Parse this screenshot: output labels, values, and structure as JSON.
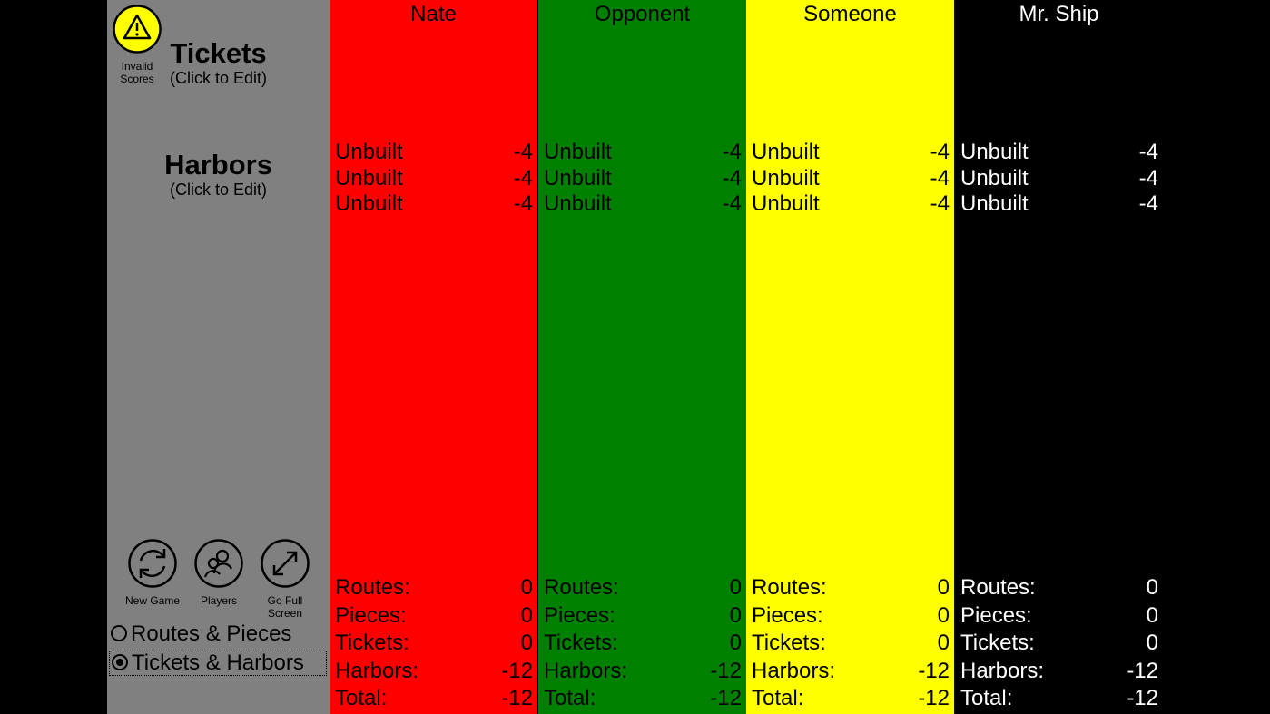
{
  "sidebar": {
    "invalid_label": "Invalid Scores",
    "tickets_title": "Tickets",
    "tickets_sub": "(Click to Edit)",
    "harbors_title": "Harbors",
    "harbors_sub": "(Click to Edit)",
    "tools": {
      "new_game": "New Game",
      "players": "Players",
      "full_screen": "Go Full Screen"
    },
    "modes": [
      {
        "label": "Routes & Pieces",
        "selected": false
      },
      {
        "label": "Tickets & Harbors",
        "selected": true
      }
    ]
  },
  "stat_labels": {
    "routes": "Routes:",
    "pieces": "Pieces:",
    "tickets": "Tickets:",
    "harbors": "Harbors:",
    "total": "Total:"
  },
  "players": [
    {
      "name": "Nate",
      "color": "#ff0000",
      "text_color": "#000000",
      "harbors": [
        {
          "label": "Unbuilt",
          "value": "-4"
        },
        {
          "label": "Unbuilt",
          "value": "-4"
        },
        {
          "label": "Unbuilt",
          "value": "-4"
        }
      ],
      "stats": {
        "routes": "0",
        "pieces": "0",
        "tickets": "0",
        "harbors": "-12",
        "total": "-12"
      }
    },
    {
      "name": "Opponent",
      "color": "#008000",
      "text_color": "#000000",
      "harbors": [
        {
          "label": "Unbuilt",
          "value": "-4"
        },
        {
          "label": "Unbuilt",
          "value": "-4"
        },
        {
          "label": "Unbuilt",
          "value": "-4"
        }
      ],
      "stats": {
        "routes": "0",
        "pieces": "0",
        "tickets": "0",
        "harbors": "-12",
        "total": "-12"
      }
    },
    {
      "name": "Someone",
      "color": "#ffff00",
      "text_color": "#000000",
      "harbors": [
        {
          "label": "Unbuilt",
          "value": "-4"
        },
        {
          "label": "Unbuilt",
          "value": "-4"
        },
        {
          "label": "Unbuilt",
          "value": "-4"
        }
      ],
      "stats": {
        "routes": "0",
        "pieces": "0",
        "tickets": "0",
        "harbors": "-12",
        "total": "-12"
      }
    },
    {
      "name": "Mr. Ship",
      "color": "#000000",
      "text_color": "#ffffff",
      "harbors": [
        {
          "label": "Unbuilt",
          "value": "-4"
        },
        {
          "label": "Unbuilt",
          "value": "-4"
        },
        {
          "label": "Unbuilt",
          "value": "-4"
        }
      ],
      "stats": {
        "routes": "0",
        "pieces": "0",
        "tickets": "0",
        "harbors": "-12",
        "total": "-12"
      }
    }
  ]
}
